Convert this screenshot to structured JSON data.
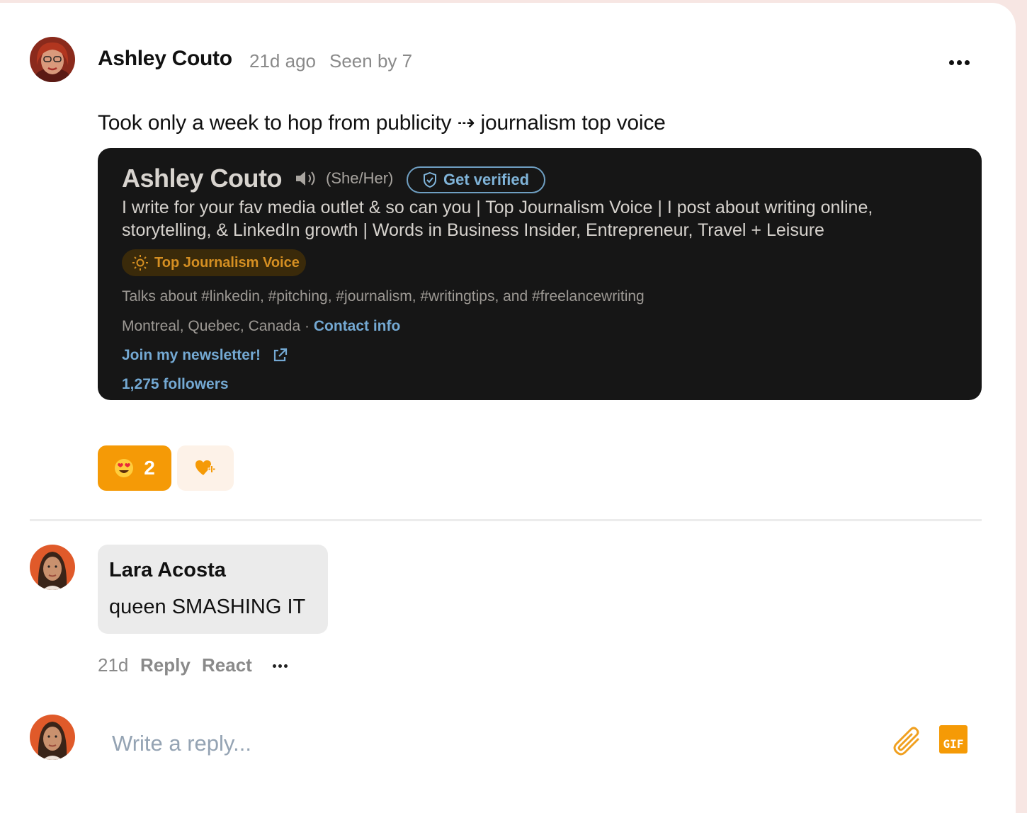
{
  "post": {
    "author": "Ashley Couto",
    "time_ago": "21d ago",
    "seen_by": "Seen by 7",
    "text": "Took only a week to hop from publicity ⇢ journalism top voice",
    "more_icon": "more-horizontal-icon"
  },
  "screenshot": {
    "name": "Ashley Couto",
    "pronouns": "(She/Her)",
    "verify_label": "Get verified",
    "headline": "I write for your fav media outlet & so can you | Top Journalism Voice | I post about writing online, storytelling, & LinkedIn growth | Words in Business Insider, Entrepreneur, Travel + Leisure",
    "badge": "Top Journalism Voice",
    "talks_about": "Talks about #linkedin, #pitching, #journalism, #writingtips, and #freelancewriting",
    "location": "Montreal, Quebec, Canada · ",
    "contact_link": "Contact info",
    "newsletter": "Join my newsletter!",
    "followers": "1,275 followers"
  },
  "reactions": {
    "emoji": "😍",
    "count": "2",
    "add_icon": "heart-plus-icon",
    "accent_color": "#f59a06"
  },
  "comment": {
    "author": "Lara Acosta",
    "text": "queen SMASHING IT",
    "time": "21d",
    "reply_label": "Reply",
    "react_label": "React"
  },
  "reply_box": {
    "placeholder": "Write a reply...",
    "attach_icon": "paperclip-icon",
    "gif_label": "GIF"
  }
}
